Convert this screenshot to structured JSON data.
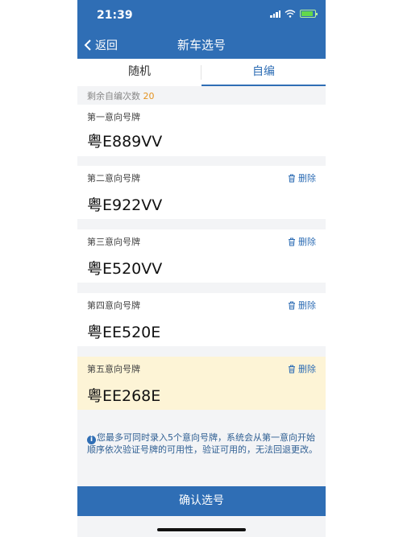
{
  "status_bar": {
    "time": "21:39"
  },
  "nav": {
    "back_label": "返回",
    "title": "新车选号"
  },
  "tabs": [
    {
      "label": "随机",
      "active": false
    },
    {
      "label": "自编",
      "active": true
    }
  ],
  "remaining": {
    "label": "剩余自编次数",
    "count": "20"
  },
  "plates": [
    {
      "label": "第一意向号牌",
      "plate": "粤E889VV",
      "deletable": false
    },
    {
      "label": "第二意向号牌",
      "plate": "粤E922VV",
      "deletable": true
    },
    {
      "label": "第三意向号牌",
      "plate": "粤E520VV",
      "deletable": true
    },
    {
      "label": "第四意向号牌",
      "plate": "粤EE520E",
      "deletable": true
    },
    {
      "label": "第五意向号牌",
      "plate": "粤EE268E",
      "deletable": true,
      "highlighted": true
    }
  ],
  "delete_label": "删除",
  "note": {
    "icon": "i",
    "text": "您最多可同时录入5个意向号牌，系统会从第一意向开始顺序依次验证号牌的可用性，验证可用的，无法回退更改。"
  },
  "confirm_label": "确认选号",
  "colors": {
    "primary": "#2f6eb5",
    "highlight": "#fdf4d6",
    "accent_count": "#e49320"
  }
}
